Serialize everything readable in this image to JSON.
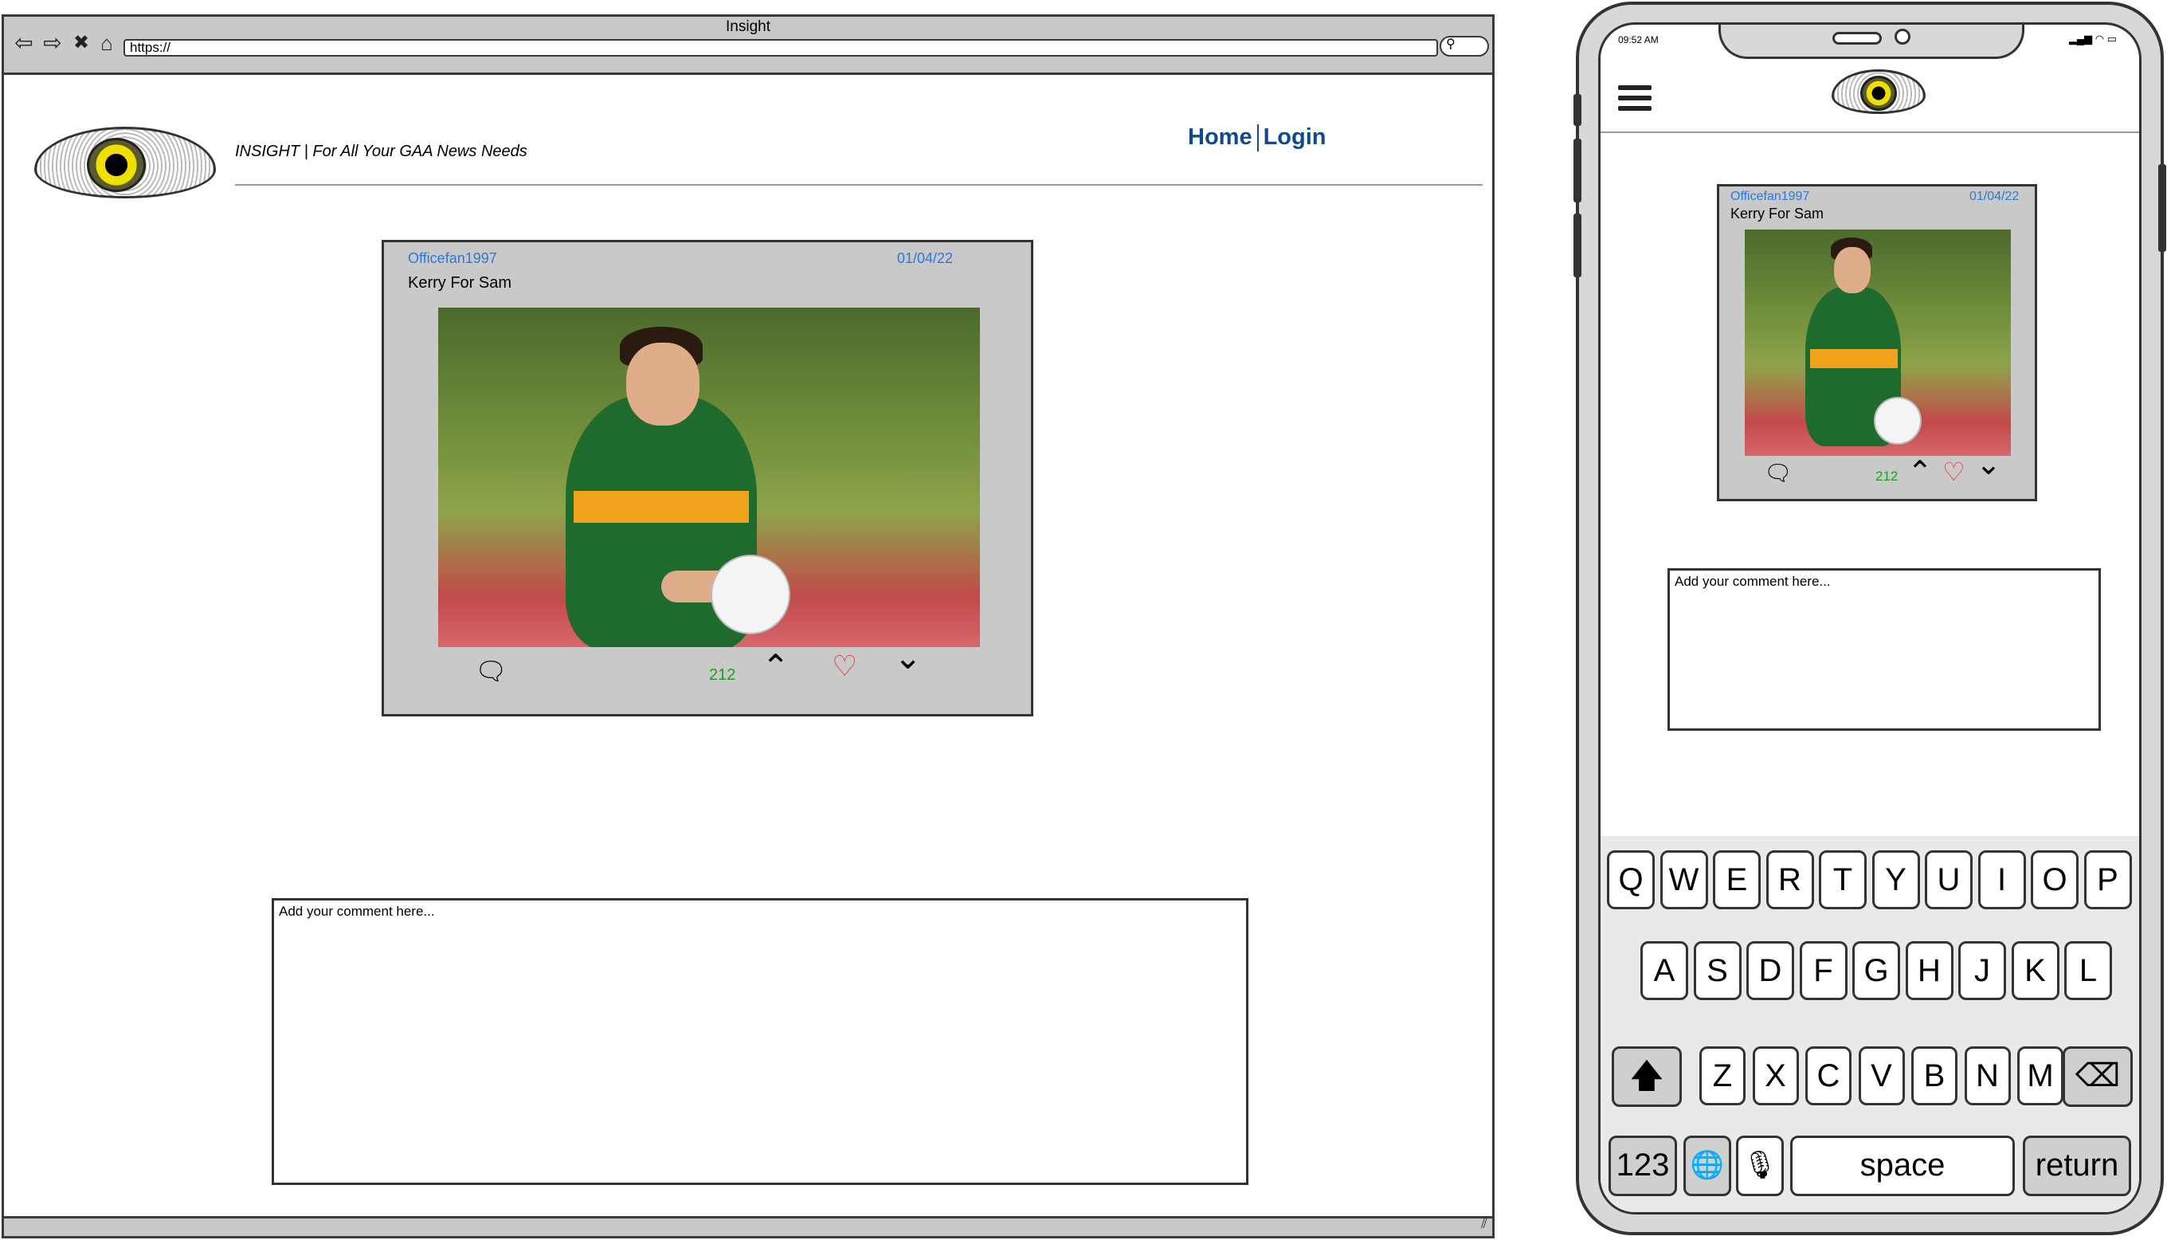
{
  "desktop": {
    "browser": {
      "title": "Insight",
      "address": "https://",
      "nav_icons": [
        "back-arrow-icon",
        "forward-arrow-icon",
        "close-icon",
        "home-icon"
      ]
    },
    "header": {
      "logo": "eye-logo",
      "tagline": "INSIGHT | For All Your GAA News Needs",
      "nav": {
        "home": "Home",
        "login": "Login"
      }
    },
    "post": {
      "author": "Officefan1997",
      "date": "01/04/22",
      "title": "Kerry For Sam",
      "image": "kerry-player-photo",
      "vote_count": "212",
      "icons": [
        "comment-icon",
        "upvote-icon",
        "heart-icon",
        "downvote-icon"
      ]
    },
    "comment": {
      "placeholder": "Add your comment here..."
    }
  },
  "mobile": {
    "status": {
      "time": "09:52 AM",
      "icons": "▂▄▆ ◠ ▭"
    },
    "post": {
      "author": "Officefan1997",
      "date": "01/04/22",
      "title": "Kerry For Sam",
      "vote_count": "212"
    },
    "comment": {
      "placeholder": "Add your comment here..."
    },
    "keyboard": {
      "row1": [
        "Q",
        "W",
        "E",
        "R",
        "T",
        "Y",
        "U",
        "I",
        "O",
        "P"
      ],
      "row2": [
        "A",
        "S",
        "D",
        "F",
        "G",
        "H",
        "J",
        "K",
        "L"
      ],
      "row3": [
        "Z",
        "X",
        "C",
        "V",
        "B",
        "N",
        "M"
      ],
      "numbers": "123",
      "space": "space",
      "return": "return"
    }
  },
  "colors": {
    "link": "#104a8e",
    "meta": "#2a7ad5",
    "count": "#1ea01e",
    "heart": "#e23b3b",
    "card_bg": "#c9c9c9"
  }
}
